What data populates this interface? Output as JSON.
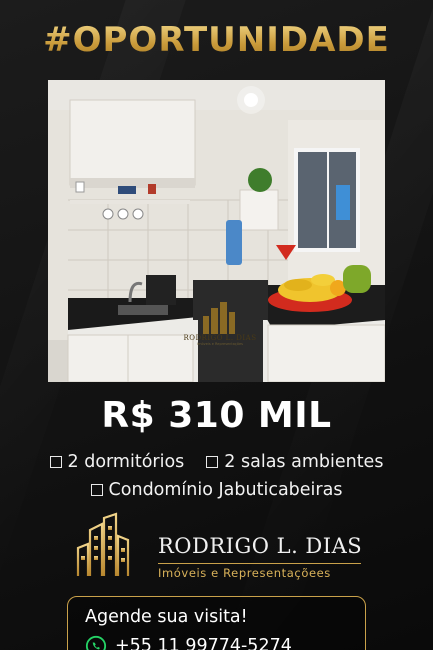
{
  "headline": "#OPORTUNIDADE",
  "price": "R$ 310 MIL",
  "features": [
    "2 dormitórios",
    "2 salas ambientes",
    "Condomínio Jabuticabeiras"
  ],
  "photo_watermark": {
    "name": "RODRIGO L. DIAS",
    "tagline": "Imóveis e Representações"
  },
  "brand": {
    "name": "RODRIGO L. DIAS",
    "tagline": "Imóveis e Representaçõees"
  },
  "cta": {
    "title": "Agende sua visita!",
    "phone": "+55 11 99774-5274"
  },
  "icons": {
    "checkbox": "checkbox-icon",
    "whatsapp": "whatsapp-icon",
    "building_logo": "building-logo-icon"
  },
  "colors": {
    "gold": "#c9a14a",
    "background": "#141414",
    "text": "#ffffff",
    "whatsapp_green": "#25d366"
  }
}
